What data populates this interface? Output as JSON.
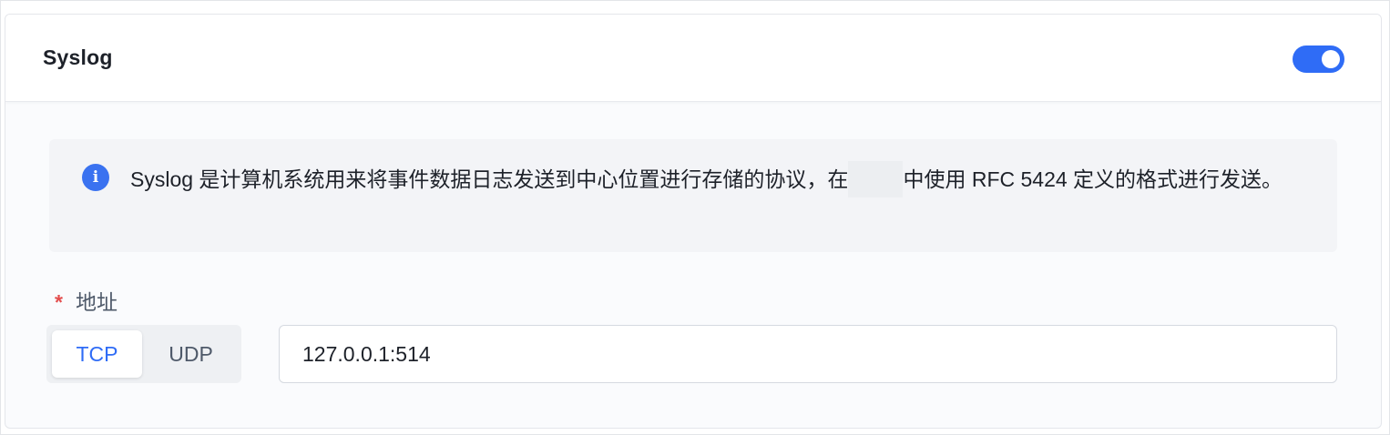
{
  "header": {
    "title": "Syslog",
    "toggle_enabled": true
  },
  "info": {
    "icon": "info-icon",
    "icon_glyph": "i",
    "text_before": "Syslog 是计算机系统用来将事件数据日志发送到中心位置进行存储的协议，在",
    "text_after": "中使用 RFC 5424 定义的格式进行发送。"
  },
  "address": {
    "required_mark": "*",
    "label": "地址",
    "protocols": [
      "TCP",
      "UDP"
    ],
    "selected_protocol": "TCP",
    "value": "127.0.0.1:514"
  },
  "colors": {
    "accent": "#2f6cf6",
    "info_icon": "#3a72f0",
    "required": "#e34d4d"
  }
}
